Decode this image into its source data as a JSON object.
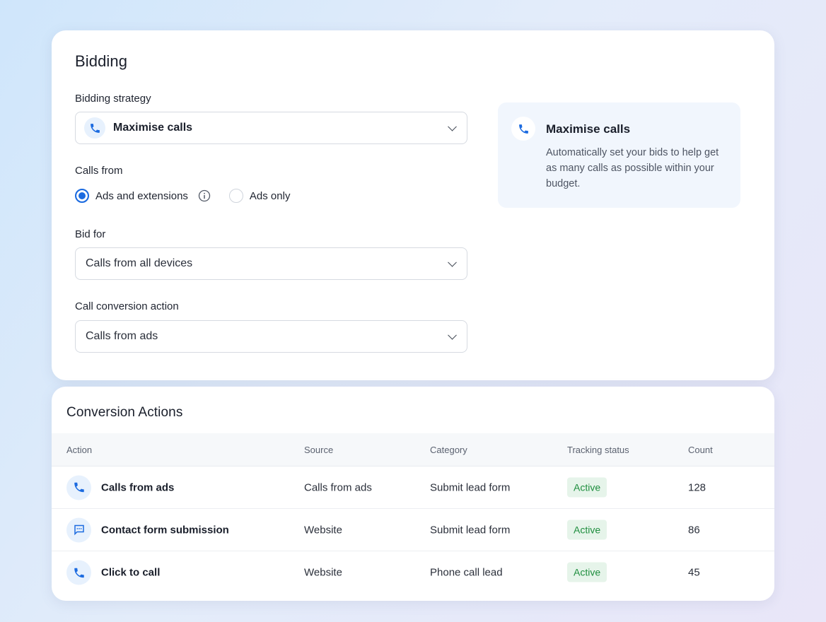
{
  "colors": {
    "accent": "#1c6be0",
    "active_bg": "#e6f4ea",
    "active_text": "#1e8e3e"
  },
  "bidding": {
    "title": "Bidding",
    "strategy": {
      "label": "Bidding strategy",
      "value": "Maximise calls",
      "icon": "phone-icon"
    },
    "calls_from": {
      "label": "Calls from",
      "options": [
        {
          "label": "Ads and extensions",
          "selected": true
        },
        {
          "label": "Ads only",
          "selected": false
        }
      ]
    },
    "bid_for": {
      "label": "Bid for",
      "value": "Calls from all devices"
    },
    "conversion_action": {
      "label": "Call conversion action",
      "value": "Calls from ads"
    },
    "info_panel": {
      "title": "Maximise calls",
      "description": "Automatically set your bids to help get as many calls as possible within your budget.",
      "icon": "phone-icon"
    }
  },
  "conversions": {
    "title": "Conversion Actions",
    "columns": [
      "Action",
      "Source",
      "Category",
      "Tracking status",
      "Count"
    ],
    "rows": [
      {
        "icon": "phone-icon",
        "action": "Calls from ads",
        "source": "Calls from ads",
        "category": "Submit lead form",
        "status": "Active",
        "count": "128"
      },
      {
        "icon": "chat-icon",
        "action": "Contact form submission",
        "source": "Website",
        "category": "Submit lead form",
        "status": "Active",
        "count": "86"
      },
      {
        "icon": "phone-icon",
        "action": "Click to call",
        "source": "Website",
        "category": "Phone call lead",
        "status": "Active",
        "count": "45"
      }
    ]
  }
}
